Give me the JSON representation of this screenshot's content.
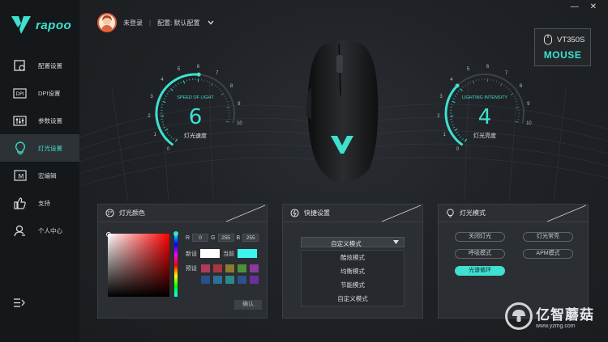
{
  "brand": {
    "logo_text": "rapoo"
  },
  "sidebar": {
    "items": [
      {
        "label": "配置设置",
        "icon": "config-icon"
      },
      {
        "label": "DPI设置",
        "icon": "dpi-icon"
      },
      {
        "label": "参数设置",
        "icon": "sliders-icon"
      },
      {
        "label": "灯光设置",
        "icon": "bulb-icon",
        "active": true
      },
      {
        "label": "宏编辑",
        "icon": "macro-icon"
      },
      {
        "label": "支持",
        "icon": "thumbs-up-icon"
      },
      {
        "label": "个人中心",
        "icon": "user-icon"
      }
    ]
  },
  "header": {
    "user_name": "未登录",
    "separator": "|",
    "profile_label": "配置: 默认配置"
  },
  "window": {
    "minimize": "—",
    "close": "✕"
  },
  "device": {
    "model": "VT350S",
    "type": "MOUSE"
  },
  "gauges": {
    "speed": {
      "title": "SPEED OF LIGHT",
      "value": "6",
      "label": "灯光速度",
      "level": 6,
      "max": 10
    },
    "intensity": {
      "title": "LIGHTING INTENSITY",
      "value": "4",
      "label": "灯光亮度",
      "level": 4,
      "max": 10
    },
    "ticks": [
      "0",
      "1",
      "2",
      "3",
      "4",
      "5",
      "6",
      "7",
      "8",
      "9",
      "10"
    ]
  },
  "color_panel": {
    "title": "灯光颜色",
    "r_label": "R",
    "r": "0",
    "g_label": "G",
    "g": "255",
    "b_label": "B",
    "b": "255",
    "new_label": "新设",
    "current_label": "当前",
    "preset_label": "预设",
    "presets": [
      "#b23a5c",
      "#a8373f",
      "#8b7a2f",
      "#4e8f3a",
      "#8a3a9b",
      "#2a4e8a",
      "#2c6f9b",
      "#2a8a8a",
      "#2f4f8f",
      "#6b2f9b"
    ],
    "confirm": "确认"
  },
  "shortcut_panel": {
    "title": "快捷设置",
    "selected": "自定义模式",
    "options": [
      "酷炫模式",
      "均衡模式",
      "节能模式",
      "自定义模式"
    ]
  },
  "light_mode_panel": {
    "title": "灯光模式",
    "modes": [
      "关闭灯光",
      "灯光常亮",
      "呼吸模式",
      "APM模式",
      "光谱循环"
    ],
    "active": "光谱循环"
  },
  "watermark": {
    "text": "亿智蘑菇",
    "url": "www.yzmg.com"
  },
  "colors": {
    "accent": "#3fe0cf",
    "background": "#1c1f22",
    "sidebar": "#15181a"
  }
}
